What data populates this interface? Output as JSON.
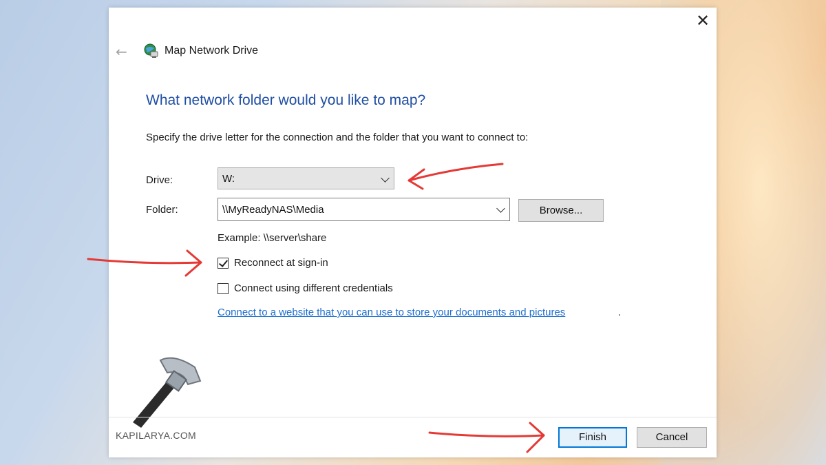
{
  "window": {
    "title": "Map Network Drive",
    "close_glyph": "✕",
    "back_glyph": "←"
  },
  "main": {
    "heading": "What network folder would you like to map?",
    "instructions": "Specify the drive letter for the connection and the folder that you want to connect to:",
    "drive_label": "Drive:",
    "drive_value": "W:",
    "folder_label": "Folder:",
    "folder_value": "\\\\MyReadyNAS\\Media",
    "browse_label": "Browse...",
    "example": "Example: \\\\server\\share",
    "reconnect_label": "Reconnect at sign-in",
    "reconnect_checked": true,
    "credentials_label": "Connect using different credentials",
    "credentials_checked": false,
    "link_text": "Connect to a website that you can use to store your documents and pictures",
    "link_suffix": "."
  },
  "footer": {
    "finish_label": "Finish",
    "cancel_label": "Cancel"
  },
  "watermark": {
    "text": "KAPILARYA.COM"
  },
  "colors": {
    "heading": "#1f4ea3",
    "link": "#1e6fcf",
    "annotation_arrow": "#e53935",
    "default_button_border": "#0078d7"
  },
  "icons": {
    "title_icon": "network-drive-globe-icon",
    "close": "close-icon",
    "back": "back-arrow-icon",
    "dropdown": "chevron-down-icon",
    "watermark_logo": "hammer-icon"
  }
}
